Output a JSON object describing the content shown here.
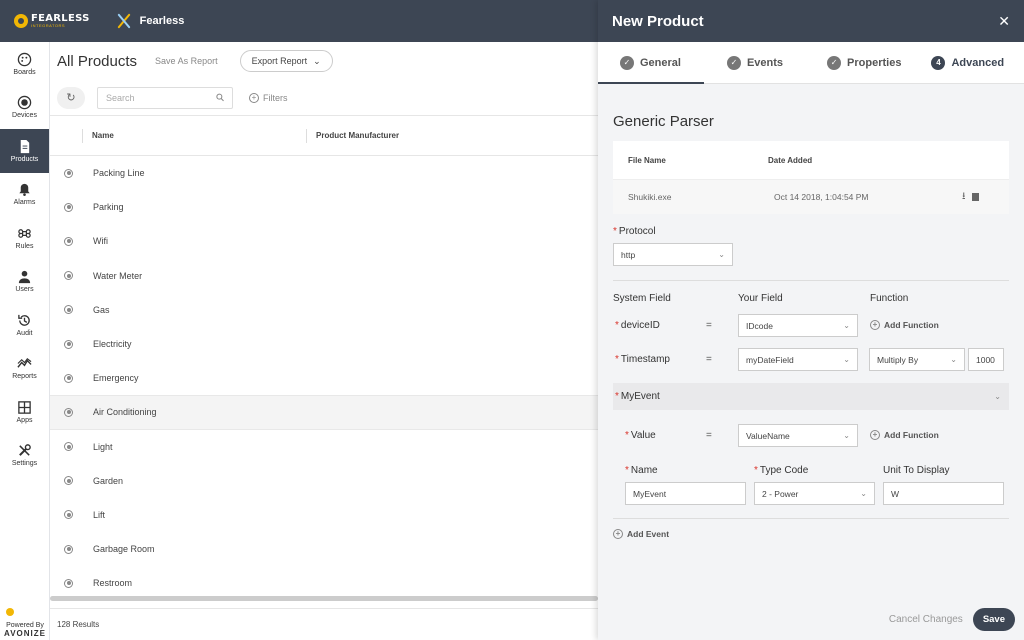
{
  "topbar": {
    "logo_big": "FEARLESS",
    "logo_small": "INTEGRATORS",
    "brand": "Fearless"
  },
  "nav": {
    "items": [
      {
        "label": "Boards",
        "icon": "palette-icon"
      },
      {
        "label": "Devices",
        "icon": "device-icon"
      },
      {
        "label": "Products",
        "icon": "document-icon",
        "active": true
      },
      {
        "label": "Alarms",
        "icon": "bell-icon"
      },
      {
        "label": "Rules",
        "icon": "command-icon"
      },
      {
        "label": "Users",
        "icon": "user-icon"
      },
      {
        "label": "Audit",
        "icon": "history-icon"
      },
      {
        "label": "Reports",
        "icon": "chart-icon"
      },
      {
        "label": "Apps",
        "icon": "grid-icon"
      },
      {
        "label": "Settings",
        "icon": "tools-icon"
      }
    ],
    "powered_by": "Powered By",
    "vendor": "AVONIZE"
  },
  "main": {
    "title": "All Products",
    "save_as_report": "Save As Report",
    "export_report": "Export Report",
    "search_placeholder": "Search",
    "filters": "Filters",
    "columns": [
      "Name",
      "Product Manufacturer"
    ],
    "rows": [
      "Packing Line",
      "Parking",
      "Wifi",
      "Water Meter",
      "Gas",
      "Electricity",
      "Emergency",
      "Air Conditioning",
      "Light",
      "Garden",
      "Lift",
      "Garbage Room",
      "Restroom"
    ],
    "results": "128 Results"
  },
  "panel": {
    "title": "New Product",
    "tabs": [
      {
        "label": "General",
        "state": "done"
      },
      {
        "label": "Events",
        "state": "done"
      },
      {
        "label": "Properties",
        "state": "done"
      },
      {
        "label": "Advanced",
        "state": "current",
        "num": "4"
      }
    ],
    "section_title": "Generic Parser",
    "file_table": {
      "headers": [
        "File Name",
        "Date Added"
      ],
      "file_name": "Shukiki.exe",
      "date_added": "Oct 14 2018, 1:04:54 PM"
    },
    "protocol_label": "Protocol",
    "protocol_value": "http",
    "mapping_headers": {
      "system": "System Field",
      "yours": "Your Field",
      "function": "Function"
    },
    "device_id": {
      "label": "deviceID",
      "eq": "=",
      "field": "IDcode",
      "add_function": "Add Function"
    },
    "timestamp": {
      "label": "Timestamp",
      "eq": "=",
      "field": "myDateField",
      "function": "Multiply By",
      "factor": "1000"
    },
    "event": {
      "name": "MyEvent",
      "value_label": "Value",
      "eq": "=",
      "value_field": "ValueName",
      "add_function": "Add Function",
      "name_label": "Name",
      "name_value": "MyEvent",
      "type_label": "Type Code",
      "type_value": "2 - Power",
      "unit_label": "Unit To Display",
      "unit_value": "W"
    },
    "add_event": "Add Event",
    "cancel": "Cancel Changes",
    "save": "Save"
  }
}
